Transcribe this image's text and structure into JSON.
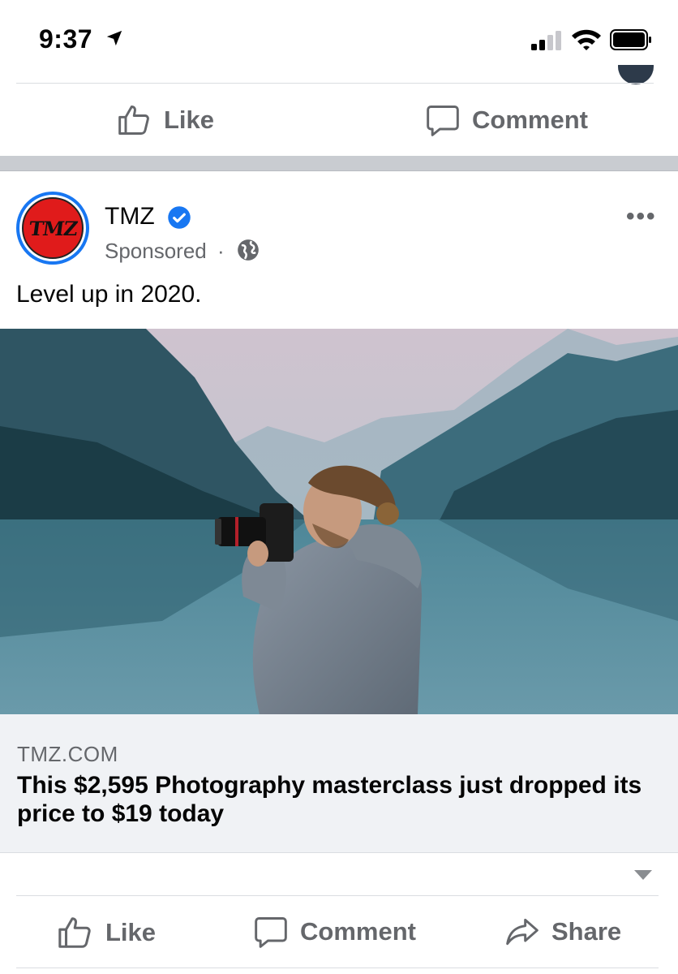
{
  "status_bar": {
    "time": "9:37"
  },
  "previous_post": {
    "like_label": "Like",
    "comment_label": "Comment"
  },
  "post": {
    "page_name": "TMZ",
    "avatar_text": "TMZ",
    "sponsored_label": "Sponsored",
    "separator": "·",
    "more_label": "•••",
    "caption": "Level up in 2020.",
    "link": {
      "domain": "TMZ.COM",
      "headline": "This $2,595 Photography masterclass just dropped its price to $19 today"
    },
    "actions": {
      "like_label": "Like",
      "comment_label": "Comment",
      "share_label": "Share"
    }
  },
  "colors": {
    "accent": "#1877f2",
    "secondary_text": "#65676b",
    "brand_red": "#e01b1b"
  }
}
